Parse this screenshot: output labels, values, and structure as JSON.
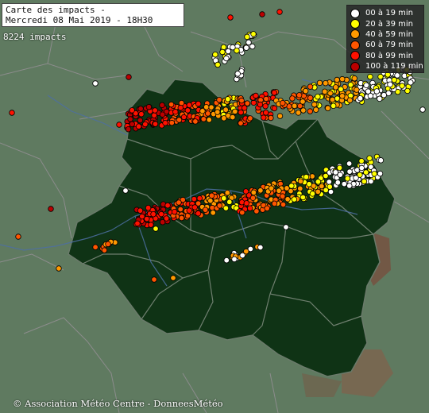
{
  "title": {
    "line1": "Carte des impacts -",
    "line2": "Mercredi 08 Mai 2019 - 18H30"
  },
  "impacts_count": "8224 impacts",
  "legend": [
    {
      "label": "00 à 19 min",
      "color": "#ffffff"
    },
    {
      "label": "20 à 39 min",
      "color": "#ffff00"
    },
    {
      "label": "40 à 59 min",
      "color": "#ff9900"
    },
    {
      "label": "60 à 79 min",
      "color": "#ff5500"
    },
    {
      "label": "80 à 99 min",
      "color": "#ff1100"
    },
    {
      "label": "100 à 119 min",
      "color": "#bb0000"
    }
  ],
  "credit": "© Association Météo Centre - DonneesMétéo",
  "colors": {
    "background_land": "#5f7a60",
    "centre_region": "#0f3315",
    "borders": "#8a8a8a",
    "rivers": "#4d6fa3",
    "relief": "#8a4d3c"
  }
}
